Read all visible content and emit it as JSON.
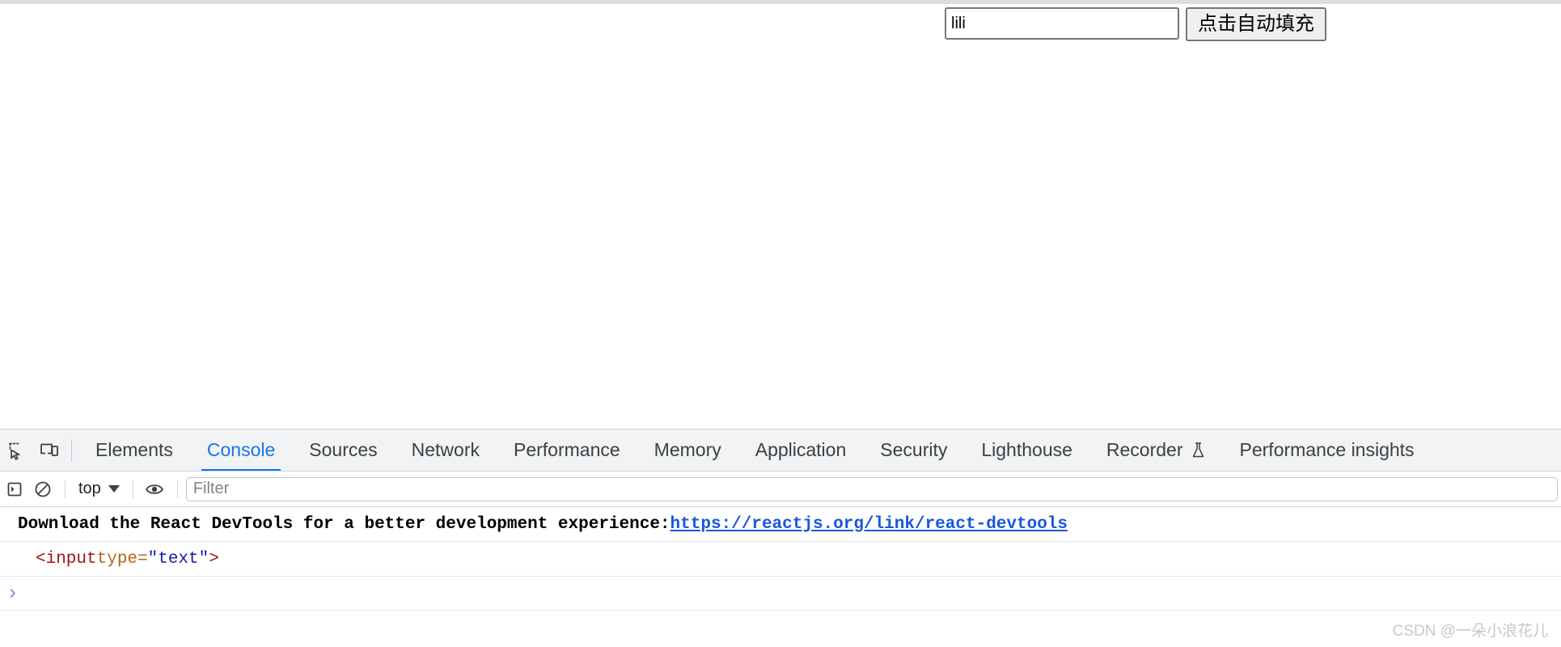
{
  "page": {
    "form": {
      "name_input_value": "lili",
      "name_input_placeholder": "",
      "fill_button_label": "点击自动填充"
    }
  },
  "devtools": {
    "icons": {
      "inspect": "inspect-element-icon",
      "device": "device-toolbar-icon"
    },
    "tabs": [
      {
        "label": "Elements",
        "active": false
      },
      {
        "label": "Console",
        "active": true
      },
      {
        "label": "Sources",
        "active": false
      },
      {
        "label": "Network",
        "active": false
      },
      {
        "label": "Performance",
        "active": false
      },
      {
        "label": "Memory",
        "active": false
      },
      {
        "label": "Application",
        "active": false
      },
      {
        "label": "Security",
        "active": false
      },
      {
        "label": "Lighthouse",
        "active": false
      },
      {
        "label": "Recorder",
        "active": false,
        "icon": "flask-icon"
      },
      {
        "label": "Performance insights",
        "active": false
      }
    ],
    "console_toolbar": {
      "sidebar_toggle": "show-console-sidebar-icon",
      "clear_console": "clear-console-icon",
      "context_selector": "top",
      "eye": "live-expressions-icon",
      "filter_placeholder": "Filter",
      "filter_value": ""
    },
    "console_messages": [
      {
        "type": "message",
        "text_before": "Download the React DevTools for a better development experience: ",
        "link_text": "https://reactjs.org/link/react-devtools"
      },
      {
        "type": "result",
        "tag_open": "<input",
        "attr_name": " type=",
        "attr_value": "\"text\"",
        "tag_close": ">"
      }
    ],
    "prompt": {
      "chevron": "›",
      "value": ""
    }
  },
  "watermark": {
    "text": "CSDN @一朵小浪花儿"
  },
  "colors": {
    "accent": "#1a73e8",
    "link": "#1a56db",
    "tabbar_bg": "#f1f3f4",
    "border": "#cdd6e4"
  }
}
